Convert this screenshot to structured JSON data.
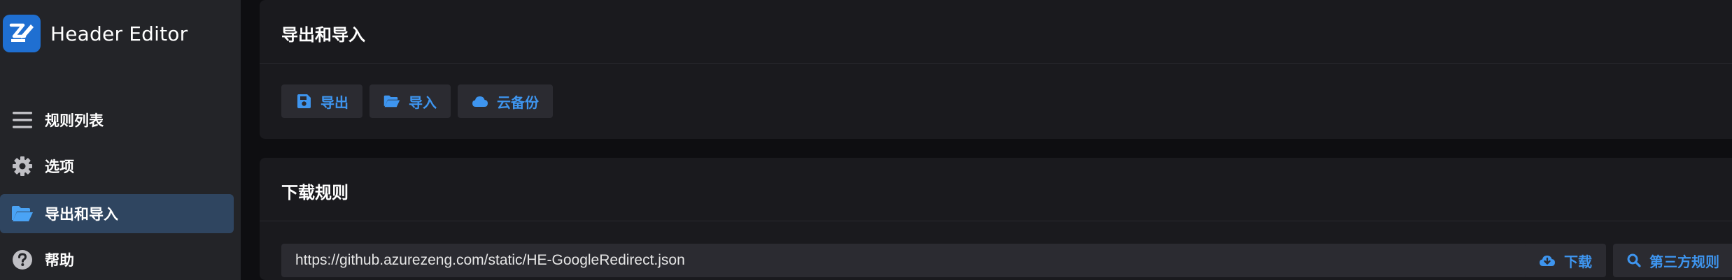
{
  "app": {
    "title": "Header Editor",
    "logo_icon": "header-editor-logo-icon",
    "accent_color": "#3e95ef"
  },
  "sidebar": {
    "items": [
      {
        "label": "规则列表",
        "icon": "list-icon",
        "active": false
      },
      {
        "label": "选项",
        "icon": "gear-icon",
        "active": false
      },
      {
        "label": "导出和导入",
        "icon": "folder-open-icon",
        "active": true
      },
      {
        "label": "帮助",
        "icon": "help-circle-icon",
        "active": false
      }
    ]
  },
  "export_import": {
    "title": "导出和导入",
    "buttons": [
      {
        "label": "导出",
        "icon": "save-icon"
      },
      {
        "label": "导入",
        "icon": "folder-open-icon"
      },
      {
        "label": "云备份",
        "icon": "cloud-icon"
      }
    ]
  },
  "download_rules": {
    "title": "下载规则",
    "url_value": "https://github.azurezeng.com/static/HE-GoogleRedirect.json",
    "download_label": "下载",
    "download_icon": "cloud-download-icon",
    "third_party_label": "第三方规则",
    "third_party_icon": "search-icon"
  }
}
